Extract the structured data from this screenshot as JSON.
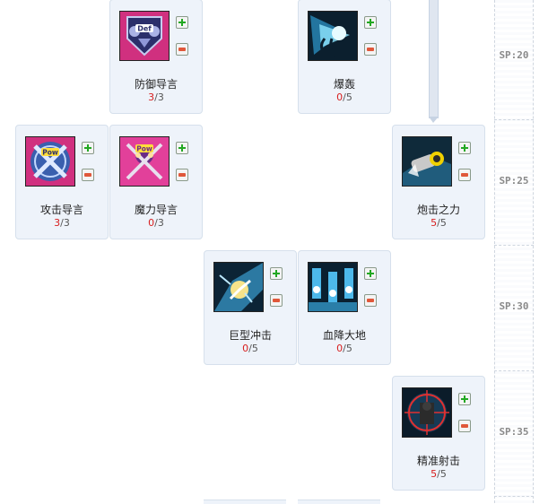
{
  "sp_rows": [
    {
      "label": "SP:20"
    },
    {
      "label": "SP:25"
    },
    {
      "label": "SP:30"
    },
    {
      "label": "SP:35"
    }
  ],
  "skills": [
    {
      "id": "defense",
      "name": "防御导言",
      "current": "3",
      "max": "/3",
      "icon": "def-banner-icon"
    },
    {
      "id": "explode",
      "name": "爆轰",
      "current": "0",
      "max": "/5",
      "icon": "burst-icon"
    },
    {
      "id": "attack",
      "name": "攻击导言",
      "current": "3",
      "max": "/3",
      "icon": "pow-crossed-icon"
    },
    {
      "id": "magic",
      "name": "魔力导言",
      "current": "0",
      "max": "/3",
      "icon": "pow-staves-icon"
    },
    {
      "id": "cannon",
      "name": "炮击之力",
      "current": "5",
      "max": "/5",
      "icon": "cannon-icon"
    },
    {
      "id": "impact",
      "name": "巨型冲击",
      "current": "0",
      "max": "/5",
      "icon": "impact-icon"
    },
    {
      "id": "bloodrain",
      "name": "血降大地",
      "current": "0",
      "max": "/5",
      "icon": "rain-cannons-icon"
    },
    {
      "id": "snipe",
      "name": "精准射击",
      "current": "5",
      "max": "/5",
      "icon": "crosshair-icon"
    }
  ],
  "colors": {
    "card_bg": "#eef3fa",
    "current_level": "#d81e1e",
    "plus": "#22a822",
    "minus": "#e0573a"
  }
}
